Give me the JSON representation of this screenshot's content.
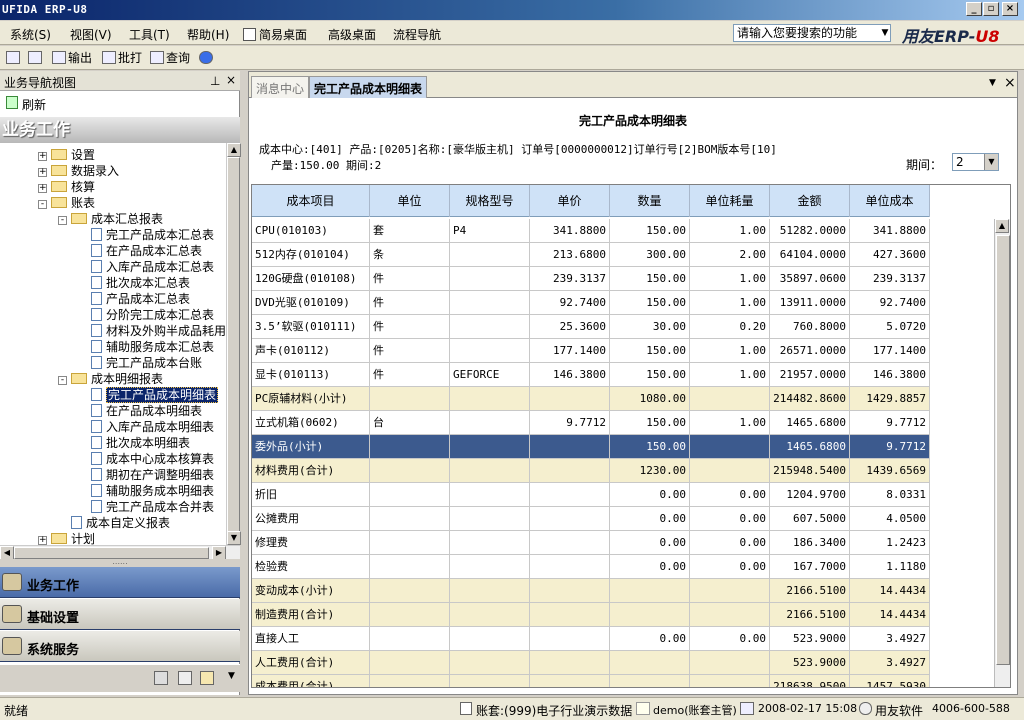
{
  "window": {
    "title": "UFIDA ERP-U8",
    "min": "_",
    "restore": "▫",
    "close": "×"
  },
  "menu": {
    "items": [
      "系统(S)",
      "视图(V)",
      "工具(T)",
      "帮助(H)",
      "简易桌面",
      "高级桌面",
      "流程导航"
    ],
    "search_placeholder": "请输入您要搜索的功能",
    "logo_main": "用友ERP-",
    "logo_accent": "U8"
  },
  "toolbar": {
    "output": "输出",
    "batch_print": "批打",
    "query": "查询"
  },
  "nav": {
    "header": "业务导航视图",
    "pin": "⊥",
    "close": "×",
    "refresh": "刷新",
    "section": "业务工作",
    "tree": [
      {
        "label": "设置",
        "type": "folder",
        "level": 0,
        "exp": "+"
      },
      {
        "label": "数据录入",
        "type": "folder",
        "level": 0,
        "exp": "+"
      },
      {
        "label": "核算",
        "type": "folder",
        "level": 0,
        "exp": "+"
      },
      {
        "label": "账表",
        "type": "folder",
        "level": 0,
        "exp": "-"
      },
      {
        "label": "成本汇总报表",
        "type": "folder",
        "level": 1,
        "exp": "-"
      },
      {
        "label": "完工产品成本汇总表",
        "type": "doc",
        "level": 2
      },
      {
        "label": "在产品成本汇总表",
        "type": "doc",
        "level": 2
      },
      {
        "label": "入库产品成本汇总表",
        "type": "doc",
        "level": 2
      },
      {
        "label": "批次成本汇总表",
        "type": "doc",
        "level": 2
      },
      {
        "label": "产品成本汇总表",
        "type": "doc",
        "level": 2
      },
      {
        "label": "分阶完工成本汇总表",
        "type": "doc",
        "level": 2
      },
      {
        "label": "材料及外购半成品耗用",
        "type": "doc",
        "level": 2
      },
      {
        "label": "辅助服务成本汇总表",
        "type": "doc",
        "level": 2
      },
      {
        "label": "完工产品成本台账",
        "type": "doc",
        "level": 2
      },
      {
        "label": "成本明细报表",
        "type": "folder",
        "level": 1,
        "exp": "-"
      },
      {
        "label": "完工产品成本明细表",
        "type": "doc",
        "level": 2,
        "selected": true
      },
      {
        "label": "在产品成本明细表",
        "type": "doc",
        "level": 2
      },
      {
        "label": "入库产品成本明细表",
        "type": "doc",
        "level": 2
      },
      {
        "label": "批次成本明细表",
        "type": "doc",
        "level": 2
      },
      {
        "label": "成本中心成本核算表",
        "type": "doc",
        "level": 2
      },
      {
        "label": "期初在产调整明细表",
        "type": "doc",
        "level": 2
      },
      {
        "label": "辅助服务成本明细表",
        "type": "doc",
        "level": 2
      },
      {
        "label": "完工产品成本合并表",
        "type": "doc",
        "level": 2
      },
      {
        "label": "成本自定义报表",
        "type": "doc",
        "level": 1
      },
      {
        "label": "计划",
        "type": "folder",
        "level": -1,
        "exp": "+"
      }
    ],
    "outlook": [
      "业务工作",
      "基础设置",
      "系统服务"
    ]
  },
  "content": {
    "tabs": [
      {
        "label": "消息中心",
        "active": false
      },
      {
        "label": "完工产品成本明细表",
        "active": true
      }
    ],
    "report_title": "完工产品成本明细表",
    "info_line1": "成本中心:[401] 产品:[0205]名称:[豪华版主机] 订单号[0000000012]订单行号[2]BOM版本号[10]",
    "info_line2": "产量:150.00  期间:2",
    "period_label": "期间：",
    "period_value": "2",
    "columns": [
      "成本项目",
      "单位",
      "规格型号",
      "单价",
      "数量",
      "单位耗量",
      "金额",
      "单位成本"
    ],
    "rows": [
      {
        "c": [
          "CPU(010103)",
          "套",
          "P4",
          "341.8800",
          "150.00",
          "1.00",
          "51282.0000",
          "341.8800"
        ],
        "k": ""
      },
      {
        "c": [
          "512内存(010104)",
          "条",
          "",
          "213.6800",
          "300.00",
          "2.00",
          "64104.0000",
          "427.3600"
        ],
        "k": ""
      },
      {
        "c": [
          "120G硬盘(010108)",
          "件",
          "",
          "239.3137",
          "150.00",
          "1.00",
          "35897.0600",
          "239.3137"
        ],
        "k": ""
      },
      {
        "c": [
          "DVD光驱(010109)",
          "件",
          "",
          "92.7400",
          "150.00",
          "1.00",
          "13911.0000",
          "92.7400"
        ],
        "k": ""
      },
      {
        "c": [
          "3.5’软驱(010111)",
          "件",
          "",
          "25.3600",
          "30.00",
          "0.20",
          "760.8000",
          "5.0720"
        ],
        "k": ""
      },
      {
        "c": [
          "声卡(010112)",
          "件",
          "",
          "177.1400",
          "150.00",
          "1.00",
          "26571.0000",
          "177.1400"
        ],
        "k": ""
      },
      {
        "c": [
          "显卡(010113)",
          "件",
          "GEFORCE",
          "146.3800",
          "150.00",
          "1.00",
          "21957.0000",
          "146.3800"
        ],
        "k": ""
      },
      {
        "c": [
          "PC原辅材料(小计)",
          "",
          "",
          "",
          "1080.00",
          "",
          "214482.8600",
          "1429.8857"
        ],
        "k": "sub"
      },
      {
        "c": [
          "立式机箱(0602)",
          "台",
          "",
          "9.7712",
          "150.00",
          "1.00",
          "1465.6800",
          "9.7712"
        ],
        "k": ""
      },
      {
        "c": [
          "委外品(小计)",
          "",
          "",
          "",
          "150.00",
          "",
          "1465.6800",
          "9.7712"
        ],
        "k": "sel"
      },
      {
        "c": [
          "材料费用(合计)",
          "",
          "",
          "",
          "1230.00",
          "",
          "215948.5400",
          "1439.6569"
        ],
        "k": "sub"
      },
      {
        "c": [
          "折旧",
          "",
          "",
          "",
          "0.00",
          "0.00",
          "1204.9700",
          "8.0331"
        ],
        "k": ""
      },
      {
        "c": [
          "公摊费用",
          "",
          "",
          "",
          "0.00",
          "0.00",
          "607.5000",
          "4.0500"
        ],
        "k": ""
      },
      {
        "c": [
          "修理费",
          "",
          "",
          "",
          "0.00",
          "0.00",
          "186.3400",
          "1.2423"
        ],
        "k": ""
      },
      {
        "c": [
          "检验费",
          "",
          "",
          "",
          "0.00",
          "0.00",
          "167.7000",
          "1.1180"
        ],
        "k": ""
      },
      {
        "c": [
          "变动成本(小计)",
          "",
          "",
          "",
          "",
          "",
          "2166.5100",
          "14.4434"
        ],
        "k": "sub"
      },
      {
        "c": [
          "制造费用(合计)",
          "",
          "",
          "",
          "",
          "",
          "2166.5100",
          "14.4434"
        ],
        "k": "sub"
      },
      {
        "c": [
          "直接人工",
          "",
          "",
          "",
          "0.00",
          "0.00",
          "523.9000",
          "3.4927"
        ],
        "k": ""
      },
      {
        "c": [
          "人工费用(合计)",
          "",
          "",
          "",
          "",
          "",
          "523.9000",
          "3.4927"
        ],
        "k": "sub"
      },
      {
        "c": [
          "成本费用(合计)",
          "",
          "",
          "",
          "",
          "",
          "218638.9500",
          "1457.5930"
        ],
        "k": "sub"
      }
    ]
  },
  "status": {
    "left": "就绪",
    "account": "账套:(999)电子行业演示数据",
    "user": "demo(账套主管)",
    "date": "2008-02-17 15:08",
    "company": "用友软件",
    "phone": "4006-600-588"
  }
}
